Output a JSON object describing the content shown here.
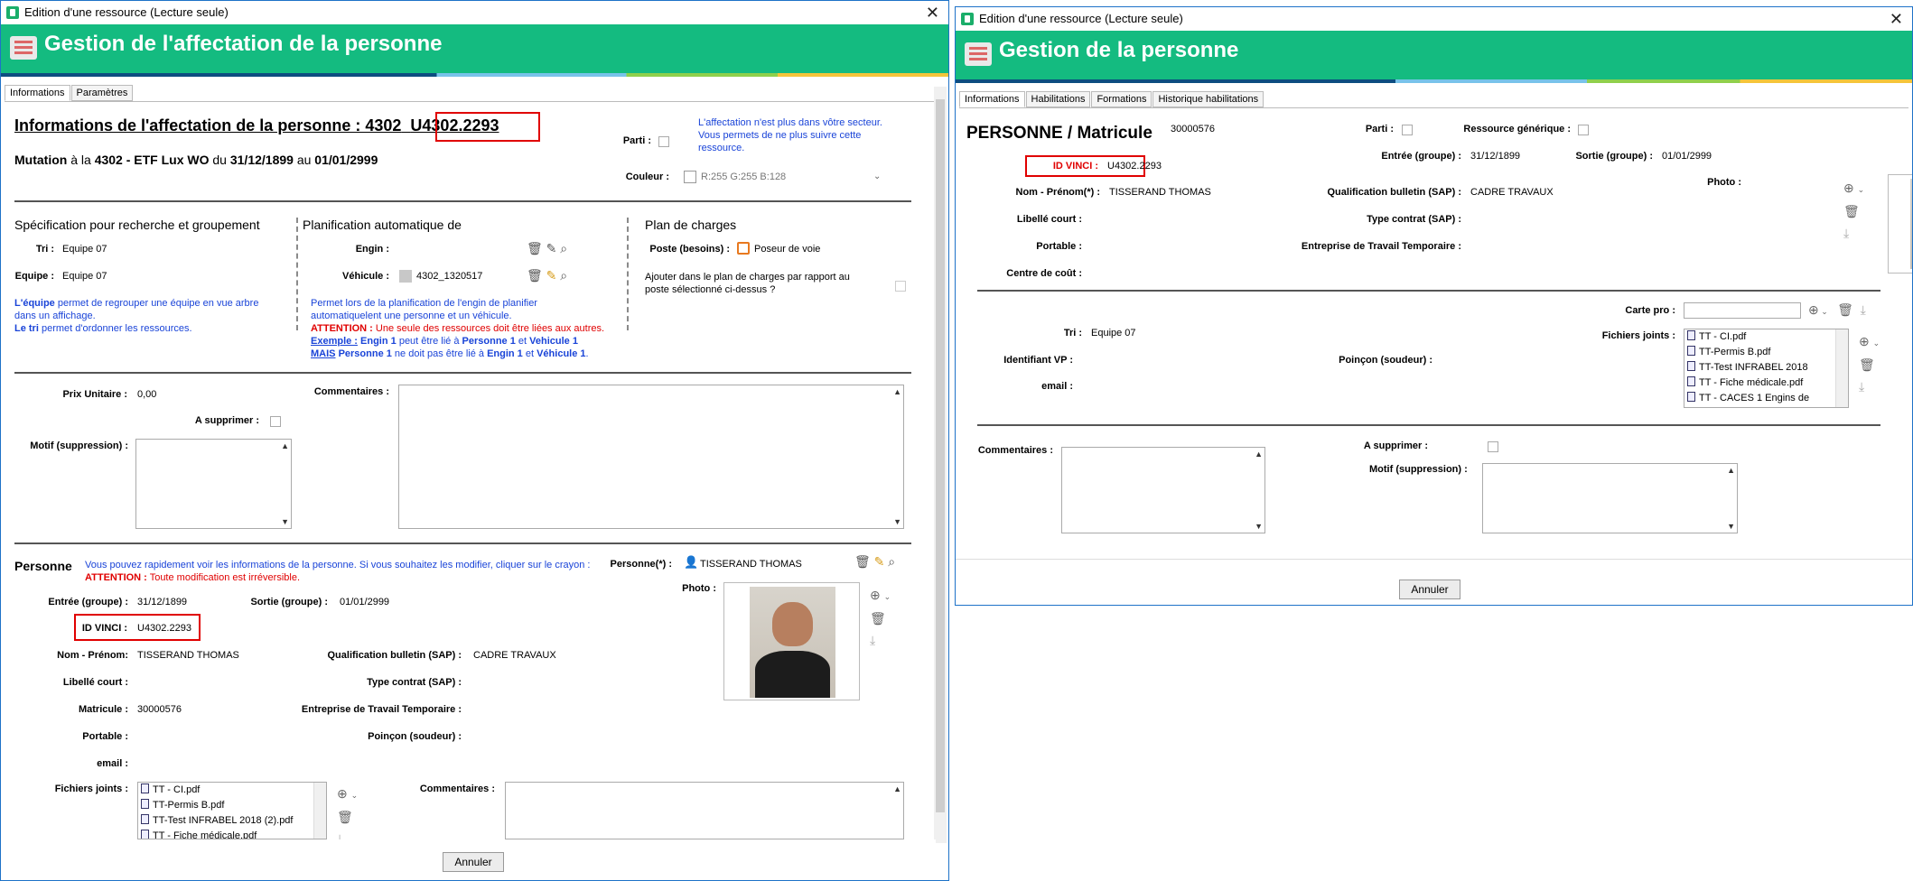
{
  "w1": {
    "title": "Edition d'une ressource (Lecture seule)",
    "close": "✕",
    "banner": "Gestion de l'affectation de la personne",
    "tabs": [
      "Informations",
      "Paramètres"
    ],
    "heading_prefix": "Informations de l'affectation de la personne : 4302",
    "heading_id": "U4302.2293",
    "mutation": {
      "a": "Mutation",
      "b": " à la ",
      "c": "4302 - ETF Lux WO",
      "d": " du ",
      "e": "31/12/1899",
      "f": " au ",
      "g": "01/01/2999"
    },
    "parti_label": "Parti :",
    "note_secteur": [
      "L'affectation n'est plus dans vôtre secteur.",
      "Vous permets de ne plus suivre cette",
      "ressource."
    ],
    "couleur_label": "Couleur :",
    "couleur_value": "R:255 G:255 B:128",
    "spec_title": "Spécification pour recherche et groupement",
    "tri_label": "Tri :",
    "tri_value": "Equipe 07",
    "equipe_label": "Equipe :",
    "equipe_value": "Equipe 07",
    "equipe_note": {
      "a": "L'équipe",
      "b": " permet de regrouper une équipe en vue arbre",
      "c": "dans un affichage.",
      "d": "Le tri",
      "e": " permet d'ordonner les ressources."
    },
    "planif_title": "Planification automatique de",
    "engin_label": "Engin :",
    "vehicule_label": "Véhicule :",
    "vehicule_value": "4302_1320517",
    "planif_note1": "Permet lors de la planification de l'engin de planifier",
    "planif_note2": "automatiquelent une personne et un véhicule.",
    "attention1": "ATTENTION :",
    "attention1_text": " Une seule des ressources doit être liées aux autres.",
    "exemple": {
      "a": "Exemple :",
      "b": " ",
      "c": "Engin 1",
      "d": " peut être lié à ",
      "e": "Personne 1",
      "f": " et ",
      "g": "Vehicule 1"
    },
    "mais": {
      "a": "MAIS",
      "b": " ",
      "c": "Personne 1",
      "d": " ne doit pas être lié à ",
      "e": "Engin 1",
      "f": " et ",
      "g": "Véhicule 1",
      "h": "."
    },
    "plan_title": "Plan de charges",
    "poste_label": "Poste (besoins) :",
    "poste_value": "Poseur de voie",
    "ajouter_note": [
      "Ajouter dans le plan de charges par rapport au",
      "poste sélectionné ci-dessus ?"
    ],
    "prix_label": "Prix Unitaire :",
    "prix_value": "0,00",
    "commentaires_label": "Commentaires :",
    "supprimer_label": "A supprimer :",
    "motif_label": "Motif (suppression) :",
    "personne_title": "Personne",
    "personne_note": "Vous pouvez rapidement voir les informations de la personne. Si vous souhaitez les modifier, cliquer sur le crayon :",
    "personne_attention": "ATTENTION :",
    "personne_attention_text": " Toute modification est irréversible.",
    "personne_label": "Personne(*) :",
    "personne_value": "TISSERAND THOMAS",
    "entree_label": "Entrée (groupe) :",
    "entree_value": "31/12/1899",
    "sortie_label": "Sortie (groupe) :",
    "sortie_value": "01/01/2999",
    "photo_label": "Photo :",
    "idvinci_label": "ID VINCI :",
    "idvinci_value": "U4302.2293",
    "nom_label": "Nom - Prénom:",
    "nom_value": "TISSERAND THOMAS",
    "qualif_label": "Qualification bulletin (SAP) :",
    "qualif_value": "CADRE TRAVAUX",
    "libelle_label": "Libellé court :",
    "type_label": "Type contrat (SAP) :",
    "matricule_label": "Matricule :",
    "matricule_value": "30000576",
    "entreprise_label": "Entreprise de Travail Temporaire :",
    "portable_label": "Portable :",
    "poincon_label": "Poinçon (soudeur) :",
    "email_label": "email :",
    "fichiers_label": "Fichiers joints :",
    "fichiers": [
      "TT - CI.pdf",
      "TT-Permis B.pdf",
      "TT-Test INFRABEL 2018 (2).pdf",
      "TT - Fiche médicale.pdf"
    ],
    "commentaires2_label": "Commentaires :",
    "annuler": "Annuler"
  },
  "w2": {
    "title": "Edition d'une ressource (Lecture seule)",
    "close": "✕",
    "banner": "Gestion de la personne",
    "tabs": [
      "Informations",
      "Habilitations",
      "Formations",
      "Historique habilitations"
    ],
    "heading": "PERSONNE / Matricule",
    "matricule_value": "30000576",
    "parti_label": "Parti :",
    "generique_label": "Ressource générique :",
    "idvinci_label": "ID VINCI :",
    "idvinci_value": "U4302.2293",
    "entree_label": "Entrée (groupe) :",
    "entree_value": "31/12/1899",
    "sortie_label": "Sortie (groupe) :",
    "sortie_value": "01/01/2999",
    "nom_label": "Nom - Prénom(*) :",
    "nom_value": "TISSERAND THOMAS",
    "qualif_label": "Qualification bulletin (SAP) :",
    "qualif_value": "CADRE TRAVAUX",
    "photo_label": "Photo :",
    "libelle_label": "Libellé court :",
    "type_label": "Type contrat (SAP) :",
    "portable_label": "Portable :",
    "entreprise_label": "Entreprise de Travail Temporaire :",
    "centre_label": "Centre de coût :",
    "carte_label": "Carte pro :",
    "tri_label": "Tri :",
    "tri_value": "Equipe 07",
    "fichiers_label": "Fichiers joints :",
    "fichiers": [
      "TT - CI.pdf",
      "TT-Permis B.pdf",
      "TT-Test INFRABEL 2018",
      "TT - Fiche médicale.pdf",
      "TT - CACES 1 Engins de"
    ],
    "identifiant_label": "Identifiant VP :",
    "poincon_label": "Poinçon (soudeur) :",
    "email_label": "email :",
    "commentaires_label": "Commentaires :",
    "supprimer_label": "A supprimer :",
    "motif_label": "Motif (suppression) :",
    "annuler": "Annuler"
  },
  "colors": {
    "banner": "#14bb80",
    "highlight": "#e00000",
    "note": "#1a44d8"
  }
}
